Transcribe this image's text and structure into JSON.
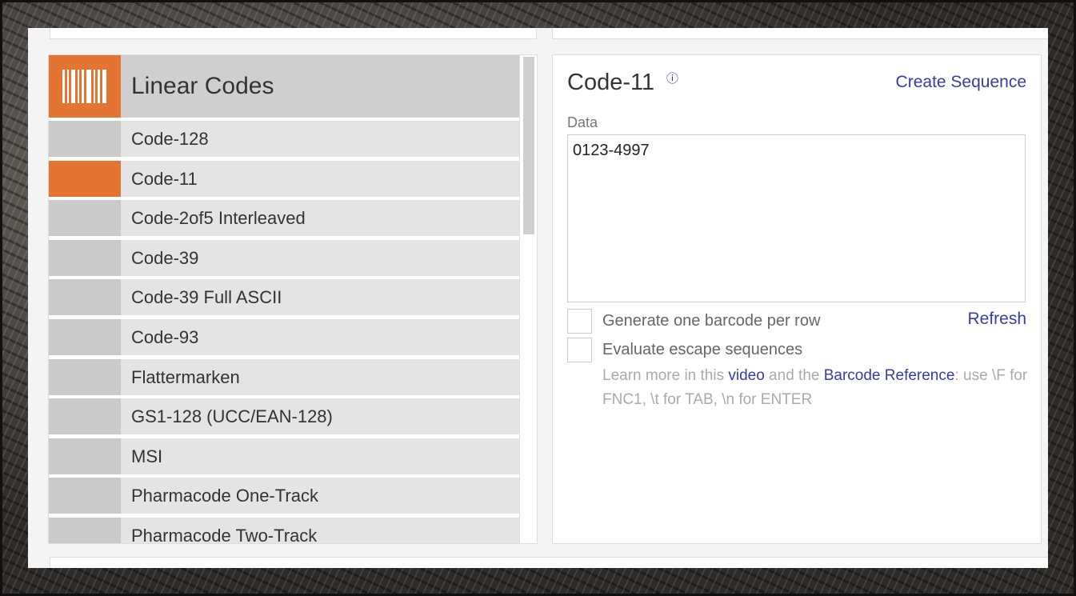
{
  "list": {
    "header": {
      "title": "Linear Codes",
      "icon": "barcode-icon",
      "accent": "#e37431"
    },
    "items": [
      {
        "label": "Code-128",
        "active": false
      },
      {
        "label": "Code-11",
        "active": true
      },
      {
        "label": "Code-2of5 Interleaved",
        "active": false
      },
      {
        "label": "Code-39",
        "active": false
      },
      {
        "label": "Code-39 Full ASCII",
        "active": false
      },
      {
        "label": "Code-93",
        "active": false
      },
      {
        "label": "Flattermarken",
        "active": false
      },
      {
        "label": "GS1-128 (UCC/EAN-128)",
        "active": false
      },
      {
        "label": "MSI",
        "active": false
      },
      {
        "label": "Pharmacode One-Track",
        "active": false
      },
      {
        "label": "Pharmacode Two-Track",
        "active": false
      }
    ]
  },
  "card": {
    "title": "Code-11",
    "info_icon": "info-icon",
    "create_sequence": "Create Sequence",
    "data_label": "Data",
    "data_value": "0123-4997",
    "option1": "Generate one barcode per row",
    "option2": "Evaluate escape sequences",
    "refresh": "Refresh",
    "help": {
      "prefix": "Learn more in this ",
      "video_link": "video",
      "middle": " and the ",
      "reference_link": "Barcode Reference",
      "suffix": ": use \\F for FNC1, \\t for TAB, \\n for ENTER"
    },
    "link_color": "#3a3aa8"
  }
}
